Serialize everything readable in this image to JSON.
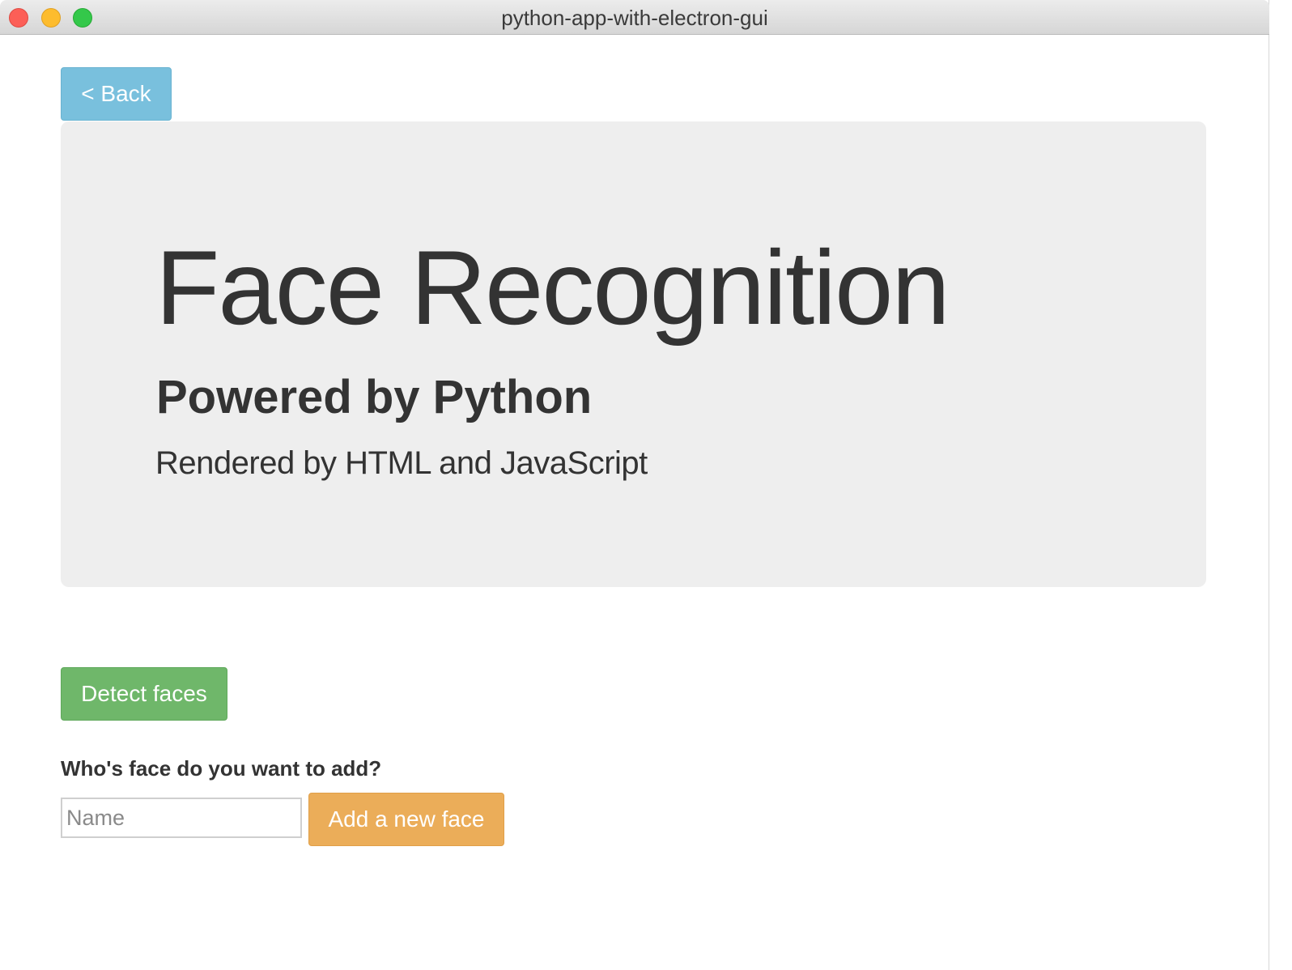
{
  "window": {
    "title": "python-app-with-electron-gui"
  },
  "nav": {
    "back_label": "< Back"
  },
  "jumbotron": {
    "title": "Face Recognition",
    "subtitle": "Powered by Python",
    "lead": "Rendered by HTML and JavaScript"
  },
  "actions": {
    "detect_label": "Detect faces"
  },
  "add_face": {
    "question": "Who's face do you want to add?",
    "input_value": "",
    "input_placeholder": "Name",
    "button_label": "Add a new face"
  },
  "colors": {
    "back_button": "#79c0dd",
    "jumbotron_bg": "#eeeeee",
    "detect_button": "#6fb76a",
    "add_button": "#ebad59",
    "text": "#333333"
  }
}
